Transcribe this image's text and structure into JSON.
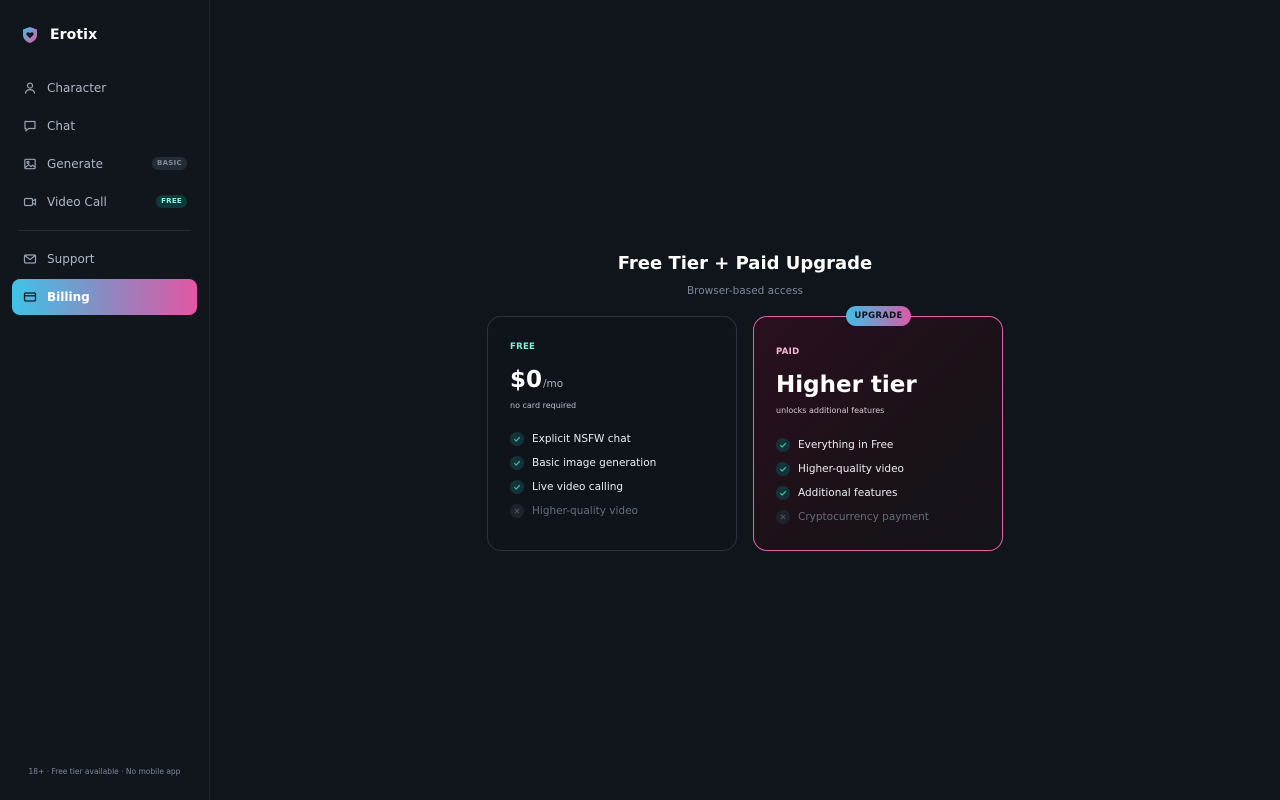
{
  "app": {
    "name": "Erotix",
    "logo_icon": "heart-shield-icon"
  },
  "sidebar": {
    "items": [
      {
        "label": "Character",
        "icon": "user-icon"
      },
      {
        "label": "Chat",
        "icon": "chat-bubble-icon"
      },
      {
        "label": "Generate",
        "icon": "image-icon",
        "badge": "BASIC"
      },
      {
        "label": "Video Call",
        "icon": "video-camera-icon",
        "badge": "FREE"
      },
      {
        "label": "Support",
        "icon": "mail-icon"
      },
      {
        "label": "Billing",
        "icon": "credit-card-icon",
        "active": true
      }
    ],
    "footer": "18+ · Free tier available · No mobile app"
  },
  "main": {
    "title": "Free Tier + Paid Upgrade",
    "subtitle": "Browser-based access",
    "free_card": {
      "tag": "FREE",
      "price": "$0",
      "price_unit": "/mo",
      "note": "no card required",
      "features": [
        {
          "text": "Explicit NSFW chat",
          "included": true
        },
        {
          "text": "Basic image generation",
          "included": true
        },
        {
          "text": "Live video calling",
          "included": true
        },
        {
          "text": "Higher-quality video",
          "included": false
        }
      ]
    },
    "paid_card": {
      "pill": "UPGRADE",
      "tag": "PAID",
      "title": "Higher tier",
      "note": "unlocks additional features",
      "features": [
        {
          "text": "Everything in Free",
          "included": true
        },
        {
          "text": "Higher-quality video",
          "included": true
        },
        {
          "text": "Additional features",
          "included": true
        },
        {
          "text": "Cryptocurrency payment",
          "included": false
        }
      ]
    }
  },
  "colors": {
    "accent_cyan": "#3ec3e8",
    "accent_pink": "#e356a4",
    "free_tag": "#7ef0d6",
    "paid_border": "#e066a8",
    "background": "#10141b"
  }
}
